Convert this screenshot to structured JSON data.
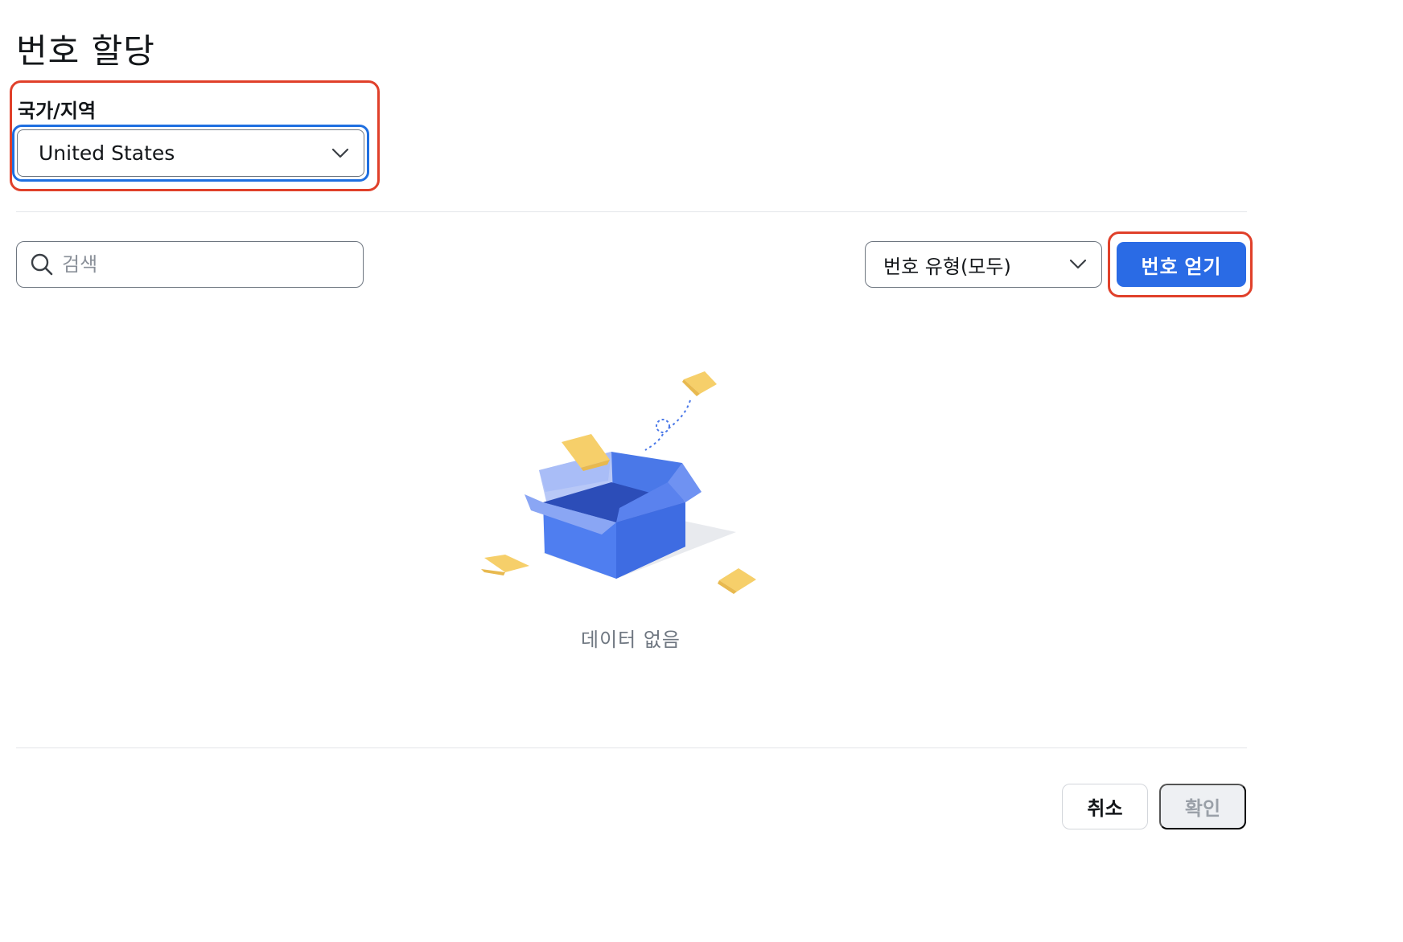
{
  "dialog": {
    "title": "번호 할당"
  },
  "country": {
    "label": "국가/지역",
    "selected": "United States"
  },
  "search": {
    "placeholder": "검색",
    "value": ""
  },
  "number_type": {
    "selected": "번호 유형(모두)"
  },
  "get_number_button": {
    "label": "번호 얻기"
  },
  "empty_state": {
    "text": "데이터 없음"
  },
  "footer": {
    "cancel_label": "취소",
    "confirm_label": "확인"
  },
  "colors": {
    "primary": "#2a6be5",
    "highlight_red": "#e0402a",
    "focus_blue": "#1f6fe0",
    "box_blue": "#4a78e8",
    "paper_yellow": "#f6cf6a"
  },
  "icons": {
    "search": "search-icon",
    "dropdown": "chevron-down-icon",
    "empty": "empty-box-icon"
  }
}
